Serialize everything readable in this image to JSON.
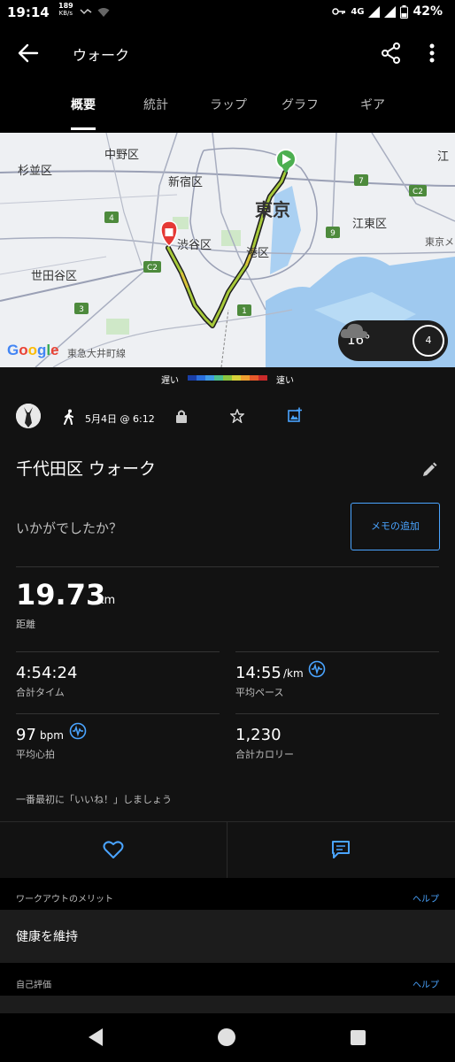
{
  "status_bar": {
    "time": "19:14",
    "net_speed_value": "189",
    "net_speed_unit": "KB/s",
    "network": "4G",
    "battery": "42%"
  },
  "header": {
    "title": "ウォーク",
    "icons": [
      "arrow-left-icon",
      "share-icon",
      "more-vert-icon"
    ]
  },
  "tabs": [
    {
      "label": "概要",
      "active": true
    },
    {
      "label": "統計",
      "active": false
    },
    {
      "label": "ラップ",
      "active": false
    },
    {
      "label": "グラフ",
      "active": false
    },
    {
      "label": "ギア",
      "active": false
    }
  ],
  "map": {
    "labels": {
      "nakano": "中野区",
      "suginami": "杉並区",
      "shinjuku": "新宿区",
      "shibuya": "渋谷区",
      "setagaya": "世田谷区",
      "tokyo": "東京",
      "minato": "港区",
      "koto": "江東区",
      "koto_partial": "江",
      "tokyo_me": "東京メ",
      "tokyu": "東急大井町線"
    },
    "route_badges": [
      "4",
      "C2",
      "C2",
      "3",
      "1",
      "7",
      "9",
      "C2"
    ],
    "google": "Google",
    "weather": {
      "temp": "16°",
      "wind": "4"
    }
  },
  "speed_legend": {
    "slow": "遅い",
    "fast": "速い",
    "colors": [
      "#1a3fa8",
      "#2a6fdd",
      "#3f9be6",
      "#4cbf8f",
      "#8cc63f",
      "#d8d23a",
      "#f0a030",
      "#e85a2a",
      "#c92a2a"
    ]
  },
  "activity": {
    "date": "5月4日 @ 6:12",
    "title": "千代田区 ウォーク",
    "feel_prompt": "いかがでしたか？",
    "memo_button": "メモの追加",
    "distance": {
      "value": "19.73",
      "unit": "km",
      "label": "距離"
    },
    "stats": {
      "time": {
        "value": "4:54:24",
        "label": "合計タイム"
      },
      "pace": {
        "value": "14:55",
        "unit": "/km",
        "label": "平均ペース"
      },
      "hr": {
        "value": "97",
        "unit": "bpm",
        "label": "平均心拍"
      },
      "calories": {
        "value": "1,230",
        "label": "合計カロリー"
      }
    },
    "like_prompt": "一番最初に「いいね！」しましょう"
  },
  "sections": {
    "benefit": {
      "title": "ワークアウトのメリット",
      "help": "ヘルプ",
      "value": "健康を維持"
    },
    "self_eval": {
      "title": "自己評価",
      "help": "ヘルプ"
    }
  }
}
